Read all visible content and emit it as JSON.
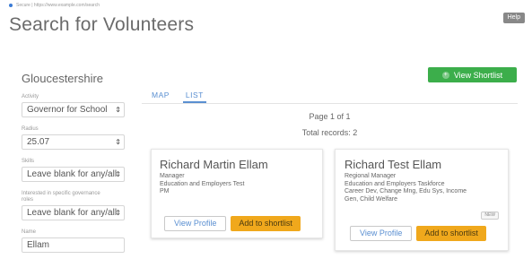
{
  "browser": {
    "url": "Secure | https://www.example.com/search"
  },
  "header": {
    "title": "Search for Volunteers",
    "help_label": "Help"
  },
  "sidebar": {
    "region": "Gloucestershire",
    "activity": {
      "label": "Activity",
      "value": "Governor for School"
    },
    "radius": {
      "label": "Radius",
      "value": "25.07"
    },
    "skills": {
      "label": "Skills",
      "value": "Leave blank for any/all"
    },
    "governance": {
      "label": "Interested in specific governance roles",
      "value": "Leave blank for any/all"
    },
    "name": {
      "label": "Name",
      "value": "Ellam"
    }
  },
  "toolbar": {
    "shortlist_label": "View Shortlist"
  },
  "tabs": [
    {
      "label": "MAP"
    },
    {
      "label": "LIST"
    }
  ],
  "results": {
    "page_text": "Page 1 of 1",
    "total_text": "Total records: 2",
    "cards": [
      {
        "name": "Richard Martin Ellam",
        "lines": [
          "Manager",
          "Education and Employers Test",
          "PM"
        ],
        "badge": "",
        "profile_label": "View Profile",
        "add_label": "Add to shortlist"
      },
      {
        "name": "Richard Test Ellam",
        "lines": [
          "Regional Manager",
          "Education and Employers Taskforce",
          "Career Dev, Change Mng, Edu Sys, Income",
          "Gen, Child Welfare"
        ],
        "badge": "NEW",
        "profile_label": "View Profile",
        "add_label": "Add to shortlist"
      }
    ]
  }
}
